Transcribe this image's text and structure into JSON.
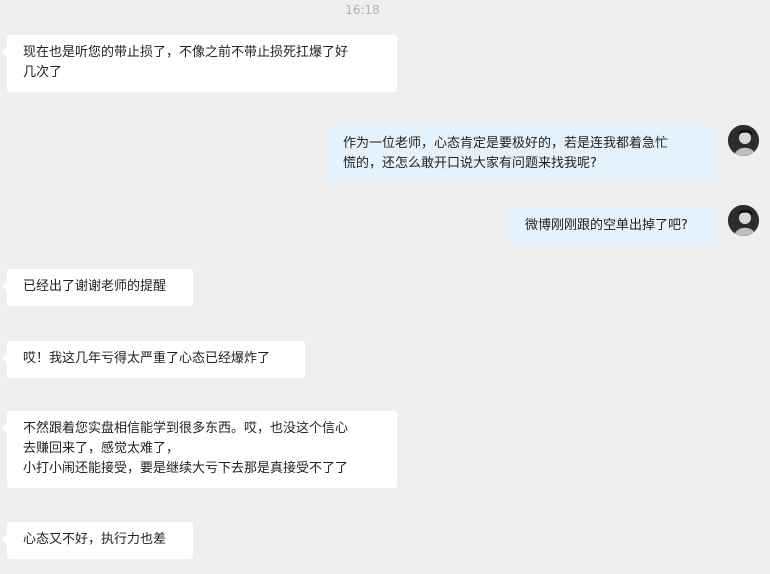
{
  "chat": {
    "timestamp": "16:18",
    "messages": [
      {
        "side": "left",
        "lines": [
          "现在也是听您的带止损了，不像之前不带止损死扛爆了好",
          "几次了"
        ]
      },
      {
        "side": "right",
        "lines": [
          "作为一位老师，心态肯定是要极好的，若是连我都着急忙",
          "慌的，还怎么敢开口说大家有问题来找我呢?"
        ]
      },
      {
        "side": "right",
        "lines": [
          "微博刚刚跟的空单出掉了吧?"
        ]
      },
      {
        "side": "left",
        "lines": [
          "已经出了谢谢老师的提醒"
        ]
      },
      {
        "side": "left",
        "lines": [
          "哎！我这几年亏得太严重了心态已经爆炸了"
        ]
      },
      {
        "side": "left",
        "lines": [
          "不然跟着您实盘相信能学到很多东西。哎，也没这个信心",
          "去赚回来了，感觉太难了，",
          "小打小闹还能接受，要是继续大亏下去那是真接受不了了"
        ]
      },
      {
        "side": "left",
        "lines": [
          "心态又不好，执行力也差"
        ]
      }
    ]
  },
  "colors": {
    "background": "#efefef",
    "incoming_bubble": "#ffffff",
    "outgoing_bubble": "#e5f1fb",
    "timestamp_text": "#b2b2b2"
  },
  "icons": {
    "avatar": "user-avatar-icon"
  }
}
